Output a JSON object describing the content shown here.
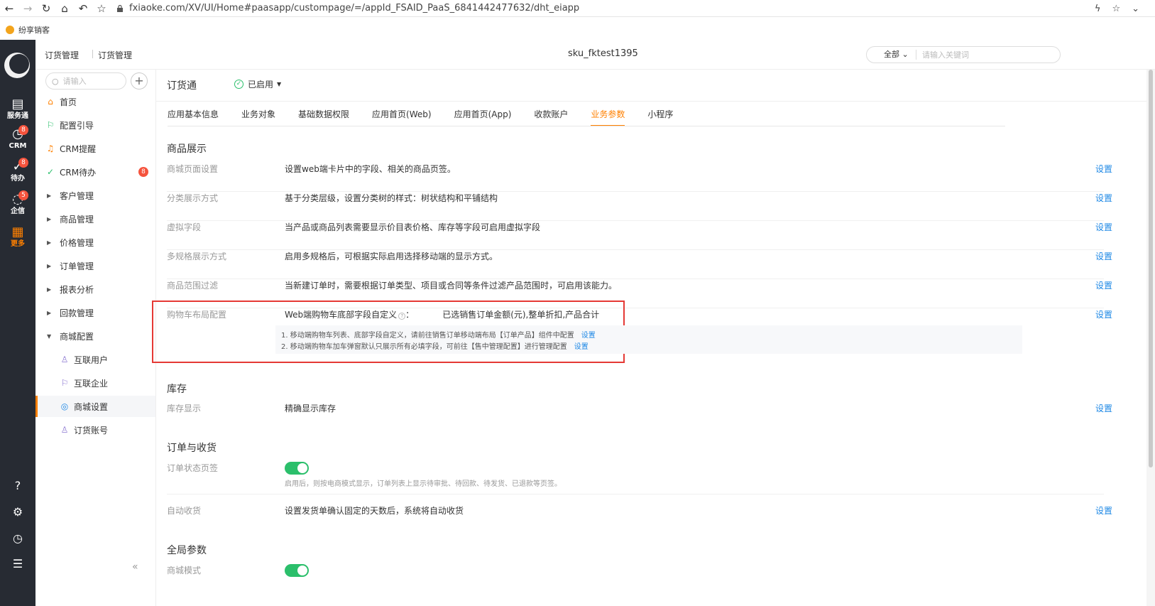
{
  "browser": {
    "url": "fxiaoke.com/XV/UI/Home#paasapp/custompage/=/appId_FSAID_PaaS_6841442477632/dht_eiapp",
    "bookmark": "纷享销客"
  },
  "rail": {
    "items": [
      {
        "label": "服务通"
      },
      {
        "label": "CRM",
        "badge": "8"
      },
      {
        "label": "待办",
        "badge": "8"
      },
      {
        "label": "企信",
        "badge": "5"
      },
      {
        "label": "更多"
      }
    ]
  },
  "header": {
    "crumb1": "订货管理",
    "crumb2": "订货管理",
    "center_title": "sku_fktest1395",
    "search_scope": "全部",
    "search_placeholder": "请输入关键词"
  },
  "sidebar": {
    "search_placeholder": "请输入",
    "items": [
      {
        "label": "首页"
      },
      {
        "label": "配置引导"
      },
      {
        "label": "CRM提醒"
      },
      {
        "label": "CRM待办",
        "badge": "8"
      },
      {
        "label": "客户管理"
      },
      {
        "label": "商品管理"
      },
      {
        "label": "价格管理"
      },
      {
        "label": "订单管理"
      },
      {
        "label": "报表分析"
      },
      {
        "label": "回款管理"
      },
      {
        "label": "商城配置"
      },
      {
        "label": "互联用户"
      },
      {
        "label": "互联企业"
      },
      {
        "label": "商城设置"
      },
      {
        "label": "订货账号"
      }
    ]
  },
  "main": {
    "title": "订货通",
    "status": "已启用",
    "tabs": [
      "应用基本信息",
      "业务对象",
      "基础数据权限",
      "应用首页(Web)",
      "应用首页(App)",
      "收款账户",
      "业务参数",
      "小程序"
    ],
    "action_label": "设置",
    "sections": {
      "product": "商品展示",
      "stock": "库存",
      "order": "订单与收货",
      "global": "全局参数"
    },
    "rows": [
      {
        "label": "商城页面设置",
        "desc": "设置web端卡片中的字段、相关的商品页签。"
      },
      {
        "label": "分类展示方式",
        "desc": "基于分类层级，设置分类树的样式：树状结构和平铺结构"
      },
      {
        "label": "虚拟字段",
        "desc": "当产品或商品列表需要显示价目表价格、库存等字段可启用虚拟字段"
      },
      {
        "label": "多规格展示方式",
        "desc": "启用多规格后，可根据实际启用选择移动端的显示方式。"
      },
      {
        "label": "商品范围过滤",
        "desc": "当新建订单时，需要根据订单类型、项目或合同等条件过滤产品范围时，可启用该能力。"
      }
    ],
    "cart": {
      "label": "购物车布局配置",
      "config_label": "Web端购物车底部字段自定义",
      "config_value": "已选销售订单金额(元),整单折扣,产品合计",
      "note1": "1. 移动端购物车列表、底部字段自定义，请前往销售订单移动端布局【订单产品】组件中配置",
      "note2": "2. 移动端购物车加车弹窗默认只展示所有必填字段，可前往【售中管理配置】进行管理配置"
    },
    "stock_row": {
      "label": "库存显示",
      "desc": "精确显示库存"
    },
    "order_status": {
      "label": "订单状态页签",
      "hint": "启用后，则按电商模式显示，订单列表上显示待审批、待回款、待发货、已退款等页签。"
    },
    "auto_receive": {
      "label": "自动收货",
      "desc": "设置发货单确认固定的天数后，系统将自动收货"
    },
    "mall_mode": {
      "label": "商城模式"
    }
  }
}
